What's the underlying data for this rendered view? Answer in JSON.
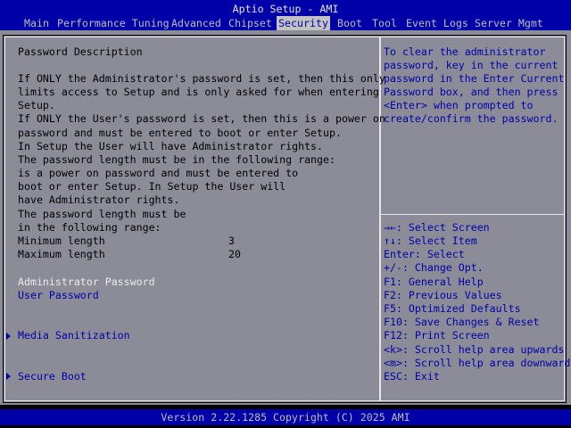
{
  "window_title": "Aptio Setup - AMI",
  "tabs": [
    {
      "label": "Main"
    },
    {
      "label": "Performance Tuning"
    },
    {
      "label": "Advanced"
    },
    {
      "label": "Chipset"
    },
    {
      "label": "Security"
    },
    {
      "label": "Boot"
    },
    {
      "label": "Tool"
    },
    {
      "label": "Event Logs"
    },
    {
      "label": "Server Mgmt"
    }
  ],
  "active_tab": "Security",
  "left": {
    "heading": "Password Description",
    "desc_lines": [
      "If ONLY the Administrator's password is set, then this only",
      "limits access to Setup and is only asked for when entering",
      "Setup.",
      "If ONLY the User's password is set, then this is a power on",
      "password and must be entered to boot or enter Setup.",
      "In Setup the User will have Administrator rights.",
      "The password length must be in the following range:",
      "is a power on password and must be entered to",
      "boot or enter Setup. In Setup the User will",
      "have Administrator rights.",
      "The password length must be",
      "in the following range:"
    ],
    "min_length_label": "Minimum length",
    "min_length_value": "3",
    "max_length_label": "Maximum length",
    "max_length_value": "20",
    "admin_password": "Administrator Password",
    "user_password": "User Password",
    "media_sanitization": "Media Sanitization",
    "secure_boot": "Secure Boot"
  },
  "help": {
    "lines": [
      "To clear the administrator",
      "password, key in the current",
      "password in the Enter Current",
      "Password box, and then press",
      "<Enter> when prompted to",
      "create/confirm the password."
    ]
  },
  "keys": [
    "→←: Select Screen",
    "↑↓: Select Item",
    "Enter: Select",
    "+/-: Change Opt.",
    "F1: General Help",
    "F2: Previous Values",
    "F5: Optimized Defaults",
    "F10: Save Changes & Reset",
    "F12: Print Screen",
    "<k>: Scroll help area upwards",
    "<m>: Scroll help area downwards",
    "ESC: Exit"
  ],
  "footer": "Version 2.22.1285 Copyright (C) 2025 AMI",
  "colors": {
    "title_bar": "#0000a8",
    "panel": "#8c8c99",
    "active_tab": "#c2c2c2",
    "selectable_text": "#0000a8",
    "highlight_text": "#eaeaea"
  }
}
